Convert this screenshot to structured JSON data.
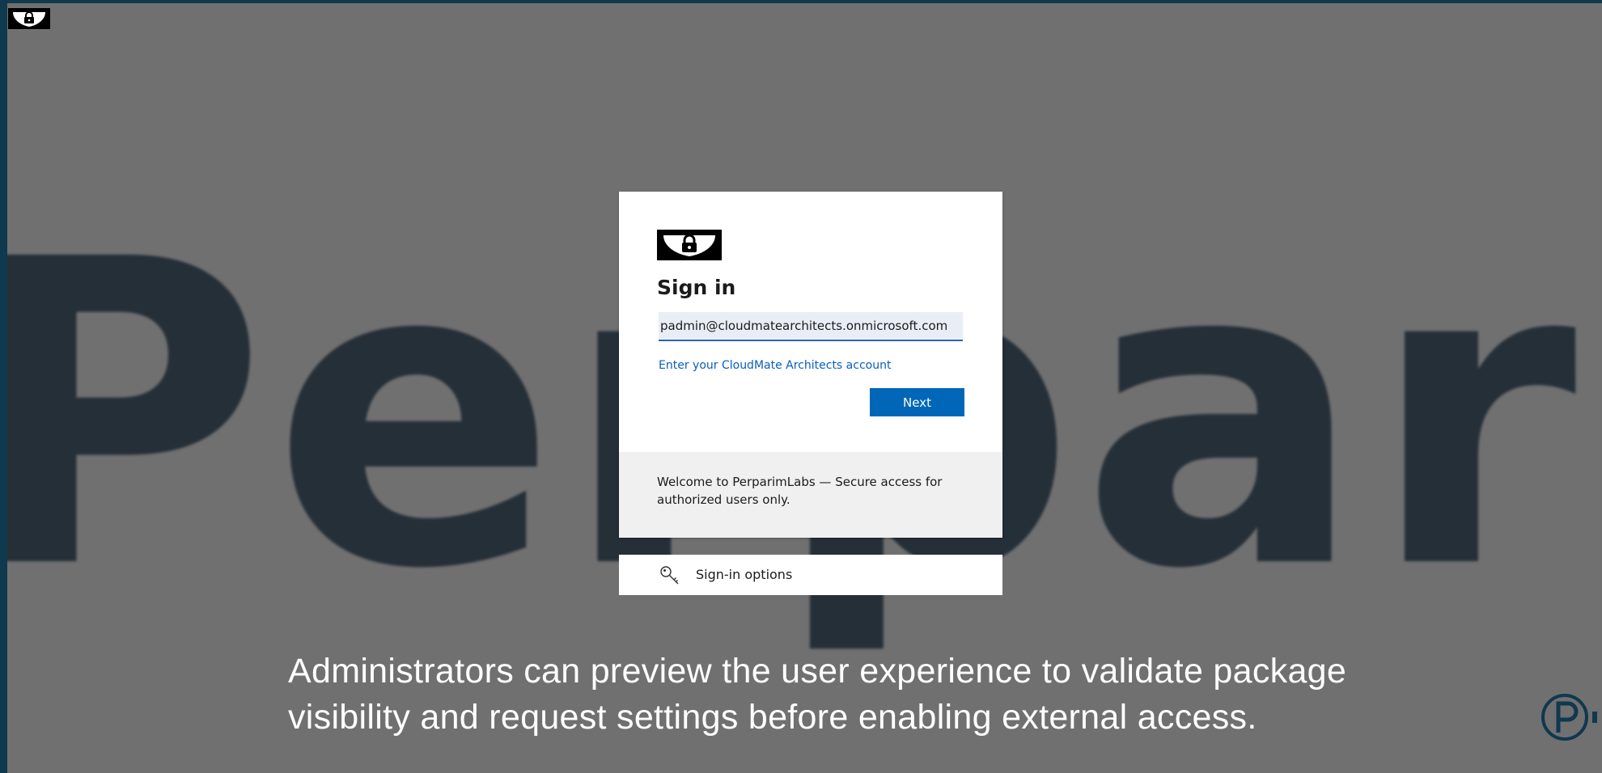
{
  "background": {
    "watermark_text": "Perparim",
    "colors": {
      "frame": "#0f3a4d",
      "overlay": "#707070",
      "watermark": "#1f2a33"
    }
  },
  "corner_logo": {
    "icon": "lock-shield-icon"
  },
  "signin_card": {
    "logo_icon": "lock-shield-icon",
    "title": "Sign in",
    "email_value": "padmin@cloudmatearchitects.onmicrosoft.com",
    "hint_link": "Enter your CloudMate Architects account",
    "next_label": "Next",
    "footer_text": "Welcome to PerparimLabs — Secure access for authorized users only.",
    "colors": {
      "primary": "#0067b8",
      "link": "#0a5ebf",
      "footer_bg": "#f0f0f0"
    }
  },
  "signin_options": {
    "icon": "key-icon",
    "label": "Sign-in options"
  },
  "caption": {
    "text": "Administrators can preview the user experience to validate package visibility and request settings before enabling external access."
  },
  "brand_mark": {
    "icon": "p-circle-logo-icon"
  }
}
